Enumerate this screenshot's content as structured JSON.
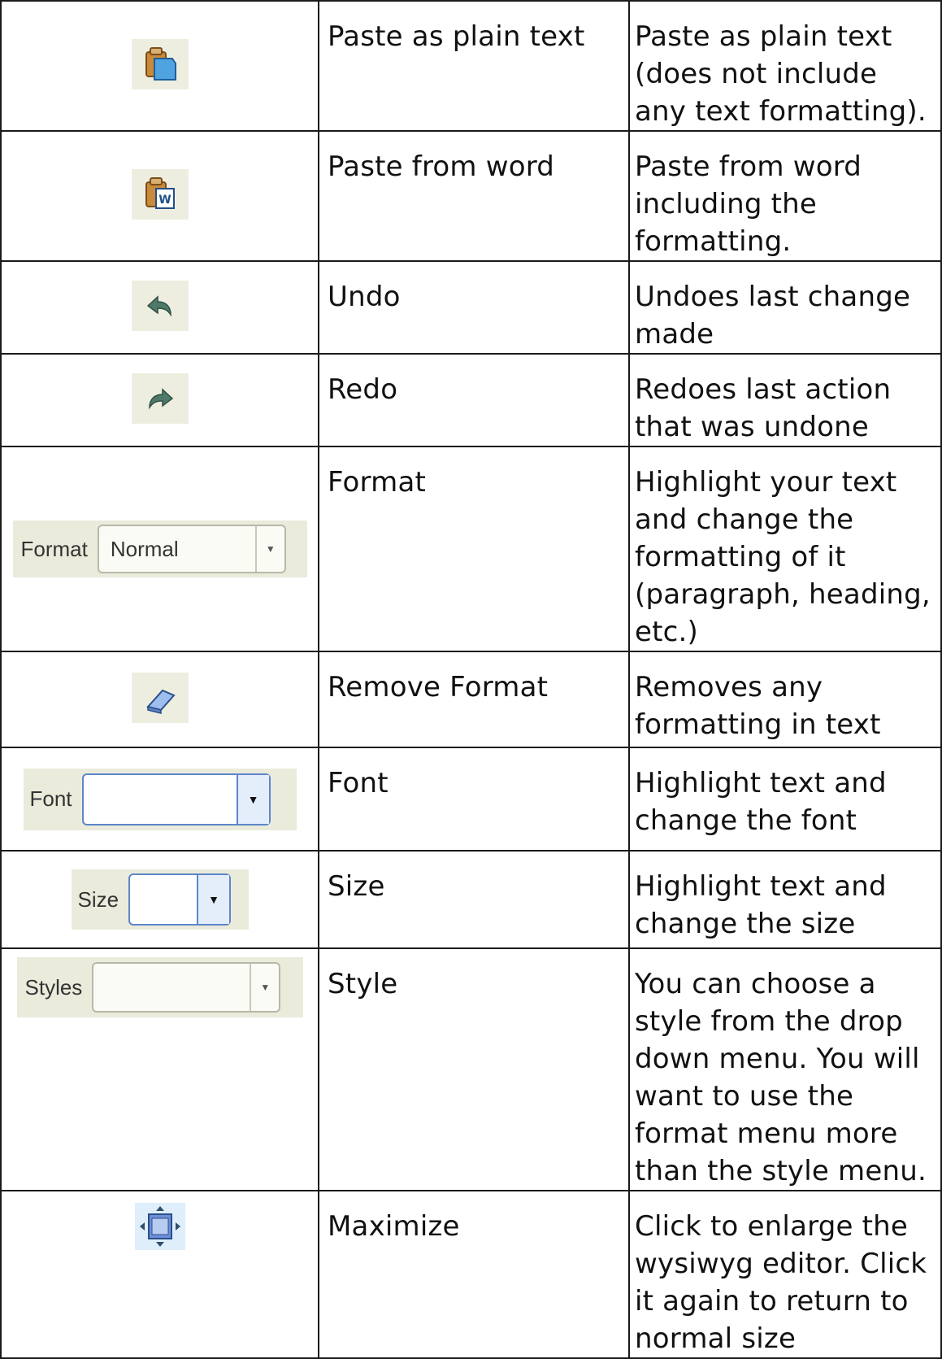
{
  "rows": [
    {
      "icon": "paste-plain-text-icon",
      "name": "Paste as plain text",
      "description": "Paste as plain text (does not include any text formatting)."
    },
    {
      "icon": "paste-from-word-icon",
      "name": "Paste from word",
      "description": "Paste from word including the formatting."
    },
    {
      "icon": "undo-icon",
      "name": "Undo",
      "description": "Undoes last change made"
    },
    {
      "icon": "redo-icon",
      "name": "Redo",
      "description": "Redoes last action that was undone"
    },
    {
      "icon": "format-dropdown",
      "name": "Format",
      "description": "Highlight your text and change the formatting of it (paragraph, heading, etc.)",
      "widget_label": "Format",
      "widget_value": "Normal"
    },
    {
      "icon": "eraser-icon",
      "name": "Remove Format",
      "description": "Removes any formatting in text"
    },
    {
      "icon": "font-dropdown",
      "name": "Font",
      "description": "Highlight text and change the font",
      "widget_label": "Font",
      "widget_value": ""
    },
    {
      "icon": "size-dropdown",
      "name": "Size",
      "description": "Highlight text and change the size",
      "widget_label": "Size",
      "widget_value": ""
    },
    {
      "icon": "styles-dropdown",
      "name": "Style",
      "description": "You can choose a style from the drop down menu. You will want to use the format menu more than the style menu.",
      "widget_label": "Styles",
      "widget_value": ""
    },
    {
      "icon": "maximize-icon",
      "name": "Maximize",
      "description": "Click to enlarge the wysiwyg editor. Click it again to return to normal size"
    }
  ]
}
